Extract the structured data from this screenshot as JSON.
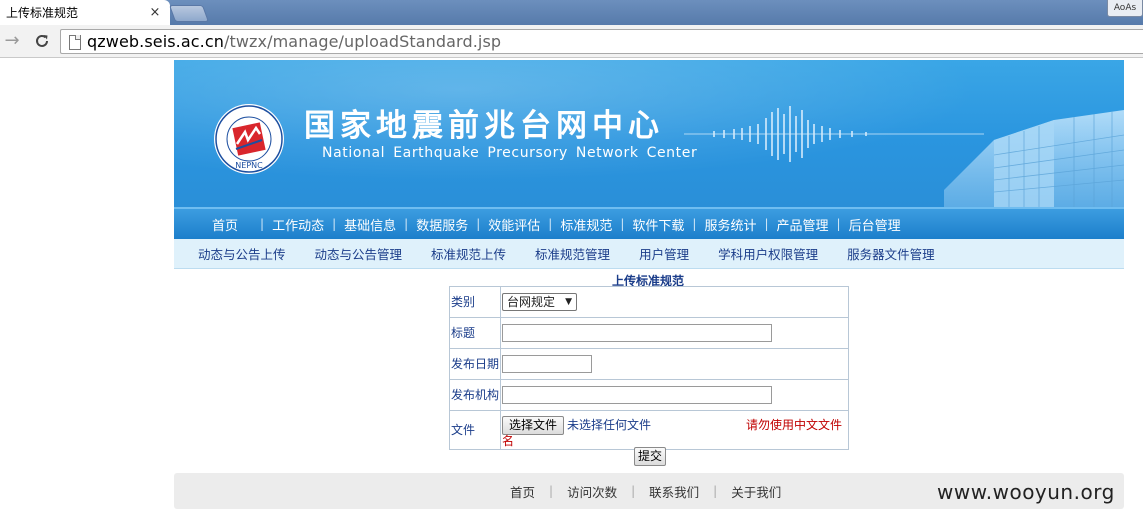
{
  "browser": {
    "tab_title": "上传标准规范",
    "tab_close": "×",
    "corner_label": "AoAs",
    "back_glyph": "→",
    "reload_glyph": "C",
    "url_host": "qzweb.seis.ac.cn",
    "url_path": "/twzx/manage/uploadStandard.jsp"
  },
  "banner": {
    "title_cn": "国家地震前兆台网中心",
    "title_en": "National Earthquake Precursory Network Center",
    "logo_text": "NEPNC"
  },
  "main_nav": {
    "items": [
      "首页",
      "工作动态",
      "基础信息",
      "数据服务",
      "效能评估",
      "标准规范",
      "软件下载",
      "服务统计",
      "产品管理",
      "后台管理"
    ],
    "separator": "|"
  },
  "sub_nav": {
    "items": [
      "动态与公告上传",
      "动态与公告管理",
      "标准规范上传",
      "标准规范管理",
      "用户管理",
      "学科用户权限管理",
      "服务器文件管理"
    ]
  },
  "form": {
    "title": "上传标准规范",
    "category_label": "类别",
    "category_value": "台网规定",
    "category_caret": "▼",
    "title_label": "标题",
    "title_value": "",
    "date_label": "发布日期",
    "date_value": "",
    "org_label": "发布机构",
    "org_value": "",
    "file_label": "文件",
    "file_button": "选择文件",
    "file_status": "未选择任何文件",
    "file_warning_line1": "请勿使用中文文件",
    "file_warning_line2": "名",
    "submit_label": "提交"
  },
  "footer": {
    "items": [
      "首页",
      "访问次数",
      "联系我们",
      "关于我们"
    ],
    "separator": "|"
  },
  "watermark": "www.wooyun.org",
  "colors": {
    "banner_blue": "#2a95df",
    "nav_blue": "#1c7fcb",
    "subnav_bg": "#dff1fb",
    "link_blue": "#1b3d8a",
    "warning_red": "#c00000"
  }
}
